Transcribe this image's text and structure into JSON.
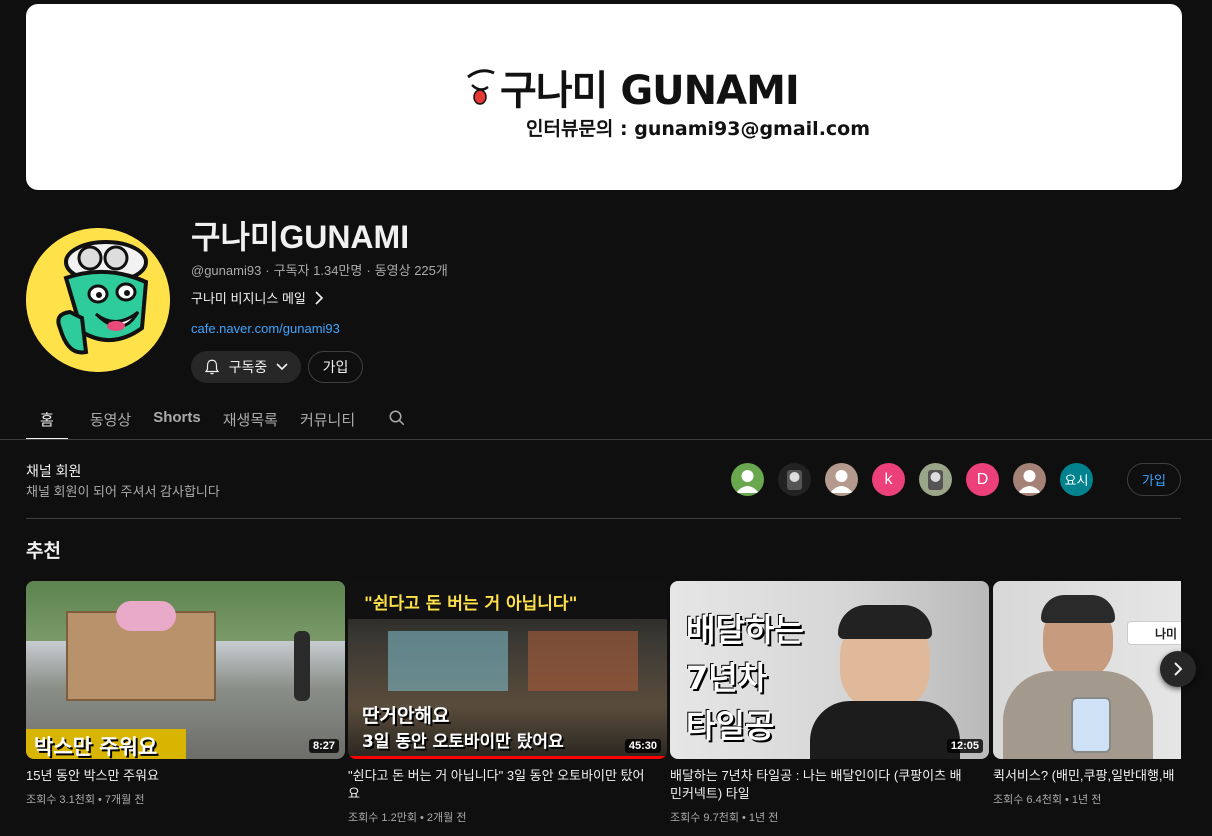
{
  "banner": {
    "title": "구나미 GUNAMI",
    "contact": "인터뷰문의 : gunami93@gmail.com"
  },
  "channel": {
    "name": "구나미GUNAMI",
    "handle": "@gunami93",
    "subscribers": "구독자 1.34만명",
    "videos_count": "동영상 225개",
    "business_label": "구나미 비지니스 메일",
    "link": "cafe.naver.com/gunami93",
    "subscribed_label": "구독중",
    "join_label": "가입"
  },
  "tabs": [
    {
      "label": "홈",
      "active": true
    },
    {
      "label": "동영상"
    },
    {
      "label": "Shorts"
    },
    {
      "label": "재생목록"
    },
    {
      "label": "커뮤니티"
    }
  ],
  "members": {
    "title": "채널 회원",
    "subtitle": "채널 회원이 되어 주셔서 감사합니다",
    "join_label": "가입",
    "avatars": [
      {
        "letter": "",
        "color": "#6aa84f",
        "icon": "person-icon"
      },
      {
        "letter": "",
        "color": "#222222",
        "icon": "photo-avatar"
      },
      {
        "letter": "",
        "color": "#b49a8c",
        "icon": "person-icon"
      },
      {
        "letter": "k",
        "color": "#ec407a"
      },
      {
        "letter": "",
        "color": "#9aa58a",
        "icon": "photo-avatar"
      },
      {
        "letter": "D",
        "color": "#ec407a"
      },
      {
        "letter": "",
        "color": "#a58277",
        "icon": "person-icon"
      },
      {
        "letter": "요시",
        "color": "#00838f"
      }
    ]
  },
  "recommended": {
    "title": "추천",
    "videos": [
      {
        "title": "15년 동안 박스만 주워요",
        "meta": "조회수 3.1천회 • 7개월 전",
        "duration": "8:27",
        "thumb_text": [
          "박스만 주워요"
        ]
      },
      {
        "title": "\"쉰다고 돈 버는 거 아닙니다\" 3일 동안 오토바이만 탔어요",
        "meta": "조회수 1.2만회 • 2개월 전",
        "duration": "45:30",
        "thumb_text": [
          "\"쉰다고 돈 버는 거 아닙니다\"",
          "딴거안해요",
          "3일 동안 오토바이만 탔어요"
        ]
      },
      {
        "title": "배달하는 7년차 타일공 : 나는 배달인이다 (쿠팡이츠 배민커넥트) 타일",
        "meta": "조회수 9.7천회 • 1년 전",
        "duration": "12:05",
        "thumb_text": [
          "배달하는",
          "7년차",
          "타일공"
        ]
      },
      {
        "title": "퀵서비스? (배민,쿠팡,일반대행,배",
        "meta": "조회수 6.4천회 • 1년 전",
        "duration": "",
        "thumb_text": [
          "나미"
        ]
      }
    ]
  }
}
